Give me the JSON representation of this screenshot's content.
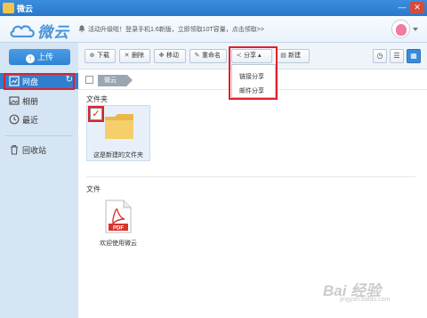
{
  "window": {
    "title": "微云",
    "minimize": "—",
    "close": "✕"
  },
  "header": {
    "brand": "微云",
    "notice": "活动升级啦！登录手机1.6新版，立即领取10T容量，点击领取>>"
  },
  "sidebar": {
    "upload_label": "上传",
    "items": [
      {
        "label": "网盘",
        "icon": "drive-icon",
        "active": true
      },
      {
        "label": "相册",
        "icon": "photo-icon",
        "active": false
      },
      {
        "label": "最近",
        "icon": "clock-icon",
        "active": false
      },
      {
        "label": "回收站",
        "icon": "trash-icon",
        "active": false
      }
    ]
  },
  "toolbar": {
    "download": "下载",
    "delete": "删除",
    "move": "移动",
    "rename": "重命名",
    "share": "分享",
    "new": "新建"
  },
  "share_menu": {
    "options": [
      "链接分享",
      "邮件分享"
    ]
  },
  "breadcrumb": {
    "root": "微云"
  },
  "sections": {
    "folders_title": "文件夹",
    "files_title": "文件"
  },
  "folders": [
    {
      "name": "这是新建的文件夹",
      "selected": true
    }
  ],
  "files": [
    {
      "name": "欢迎使用微云",
      "type_label": "PDF"
    }
  ],
  "watermark": {
    "main": "Bai 经验",
    "sub": "jingyan.baidu.com"
  },
  "colors": {
    "accent": "#2f7fcf",
    "highlight": "#e0202a",
    "pdf": "#d9332b"
  }
}
